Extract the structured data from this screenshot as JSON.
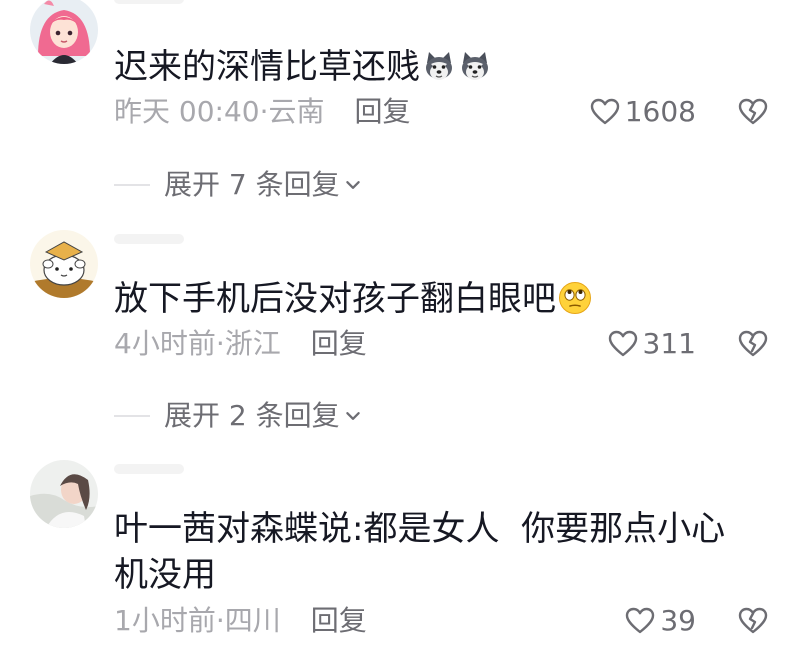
{
  "comments": [
    {
      "text": "迟来的深情比草还贱",
      "emojis": [
        "husky-emoji",
        "husky-emoji"
      ],
      "time": "昨天 00:40",
      "sep": "·",
      "region": "云南",
      "reply_label": "回复",
      "likes": "1608",
      "expand_label": "展开 7 条回复"
    },
    {
      "text": "放下手机后没对孩子翻白眼吧",
      "emojis": [
        "rolling-eyes-emoji"
      ],
      "time": "4小时前",
      "sep": "·",
      "region": "浙江",
      "reply_label": "回复",
      "likes": "311",
      "expand_label": "展开 2 条回复"
    },
    {
      "text_line1": "叶一茜对森蝶说:都是女人  你要那点小心",
      "text_line2": "机没用",
      "time": "1小时前",
      "sep": "·",
      "region": "四川",
      "reply_label": "回复",
      "likes": "39"
    }
  ],
  "colors": {
    "text": "#161823",
    "meta": "#a8a8ad",
    "action": "#6d6d73"
  },
  "icons": [
    "heart-outline-icon",
    "broken-heart-icon",
    "chevron-down-icon"
  ]
}
